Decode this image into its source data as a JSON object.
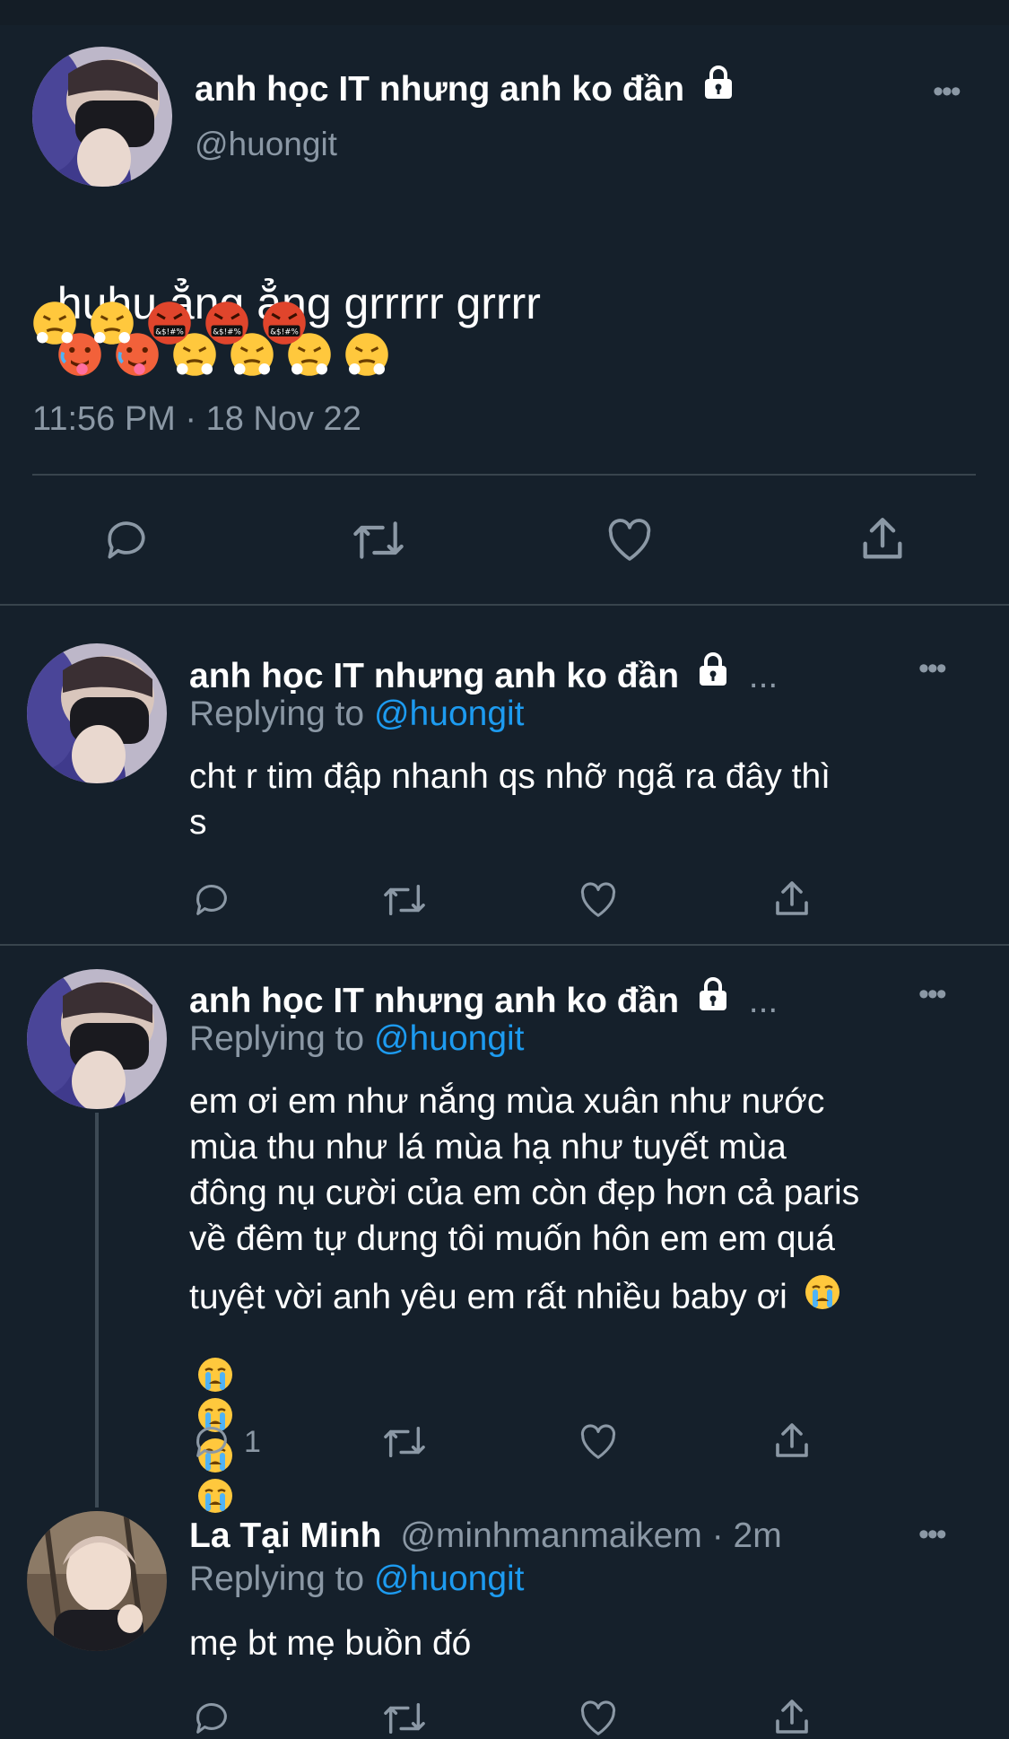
{
  "main_tweet": {
    "display_name": "anh học IT nhưng anh ko đần",
    "handle": "@huongit",
    "text": "huhu ẳng ẳng grrrrr grrrr",
    "timestamp": "11:56 PM · 18 Nov 22",
    "emoji_line1": [
      "hot-face-emoji",
      "hot-face-emoji",
      "steam-face-emoji",
      "steam-face-emoji",
      "steam-face-emoji",
      "steam-face-emoji"
    ],
    "emoji_line2": [
      "steam-face-emoji",
      "steam-face-emoji",
      "cursing-face-emoji",
      "cursing-face-emoji",
      "cursing-face-emoji"
    ]
  },
  "replies": [
    {
      "display_name": "anh học IT nhưng anh ko đần",
      "ellipsis": "...",
      "replying_label": "Replying to",
      "replying_handle": "@huongit",
      "text": "cht r tim đập nhanh qs nhỡ ngã ra đây thì\ns"
    },
    {
      "display_name": "anh học IT nhưng anh ko đần",
      "ellipsis": "...",
      "replying_label": "Replying to",
      "replying_handle": "@huongit",
      "text": "em ơi em như nắng mùa xuân như nước\nmùa thu như lá mùa hạ như tuyết mùa\nđông nụ cười của em còn đẹp hơn cả paris\nvề đêm tự dưng tôi muốn hôn em em quá",
      "text_last": "tuyệt vời anh yêu em rất nhiều baby ơi",
      "reply_count": "1"
    },
    {
      "display_name": "La Tại Minh",
      "handle_time": "@minhmanmaikem · 2m",
      "replying_label": "Replying to",
      "replying_handle": "@huongit",
      "text": "mẹ bt mẹ buồn đó"
    }
  ],
  "icons": {
    "reply": "reply-icon",
    "retweet": "retweet-icon",
    "like": "heart-icon",
    "share": "share-icon",
    "more": "more-icon",
    "lock": "lock-icon"
  },
  "colors": {
    "background": "#15202b",
    "text": "#ffffff",
    "muted": "#8b98a5",
    "link": "#1d9bf0",
    "divider": "#38444d"
  }
}
